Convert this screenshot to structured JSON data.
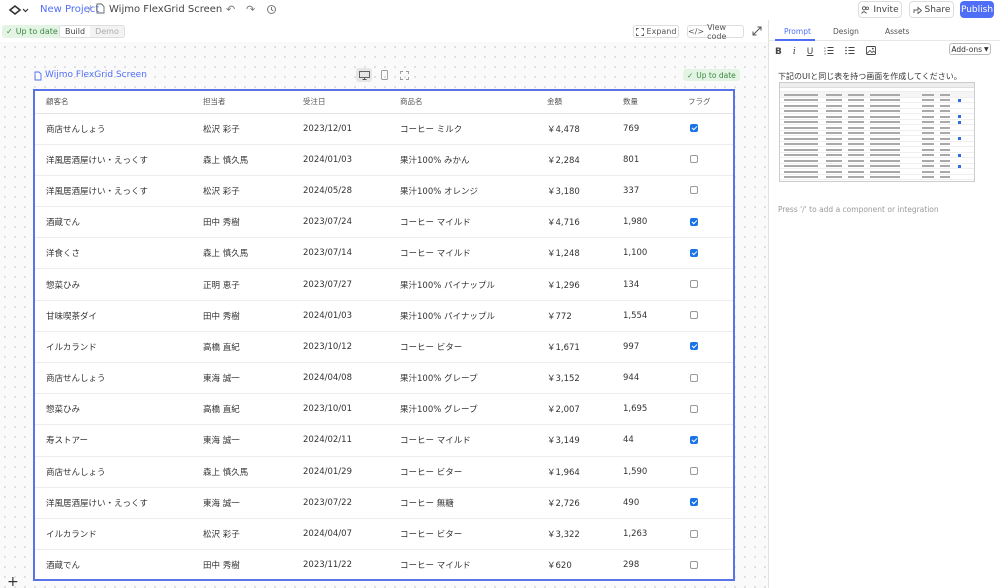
{
  "header": {
    "project_link": "New Project",
    "separator": "/",
    "file_name": "Wijmo FlexGrid Screen",
    "invite_label": "Invite",
    "share_label": "Share",
    "publish_label": "Publish"
  },
  "subbar": {
    "status_badge": "Up to date",
    "mode_build": "Build",
    "mode_demo": "Demo",
    "expand_label": "Expand",
    "view_code_label": "View code"
  },
  "frame": {
    "title": "Wijmo FlexGrid Screen",
    "status_badge": "Up to date"
  },
  "grid": {
    "columns": [
      "顧客名",
      "担当者",
      "受注日",
      "商品名",
      "金額",
      "数量",
      "フラグ"
    ],
    "rows": [
      {
        "customer": "商店せんしょう",
        "rep": "松沢 彩子",
        "date": "2023/12/01",
        "product": "コーヒー ミルク",
        "amount": "￥4,478",
        "qty": "769",
        "flag": true
      },
      {
        "customer": "洋風居酒屋けい・えっくす",
        "rep": "森上 慎久馬",
        "date": "2024/01/03",
        "product": "果汁100% みかん",
        "amount": "￥2,284",
        "qty": "801",
        "flag": false
      },
      {
        "customer": "洋風居酒屋けい・えっくす",
        "rep": "松沢 彩子",
        "date": "2024/05/28",
        "product": "果汁100% オレンジ",
        "amount": "￥3,180",
        "qty": "337",
        "flag": false
      },
      {
        "customer": "酒蔵でん",
        "rep": "田中 秀樹",
        "date": "2023/07/24",
        "product": "コーヒー マイルド",
        "amount": "￥4,716",
        "qty": "1,980",
        "flag": true
      },
      {
        "customer": "洋食くさ",
        "rep": "森上 慎久馬",
        "date": "2023/07/14",
        "product": "コーヒー マイルド",
        "amount": "￥1,248",
        "qty": "1,100",
        "flag": true
      },
      {
        "customer": "惣菜ひみ",
        "rep": "正明 恵子",
        "date": "2023/07/27",
        "product": "果汁100% パイナップル",
        "amount": "￥1,296",
        "qty": "134",
        "flag": false
      },
      {
        "customer": "甘味喫茶ダイ",
        "rep": "田中 秀樹",
        "date": "2024/01/03",
        "product": "果汁100% パイナップル",
        "amount": "￥772",
        "qty": "1,554",
        "flag": false
      },
      {
        "customer": "イルカランド",
        "rep": "高橋 直紀",
        "date": "2023/10/12",
        "product": "コーヒー ビター",
        "amount": "￥1,671",
        "qty": "997",
        "flag": true
      },
      {
        "customer": "商店せんしょう",
        "rep": "東海 誠一",
        "date": "2024/04/08",
        "product": "果汁100% グレープ",
        "amount": "￥3,152",
        "qty": "944",
        "flag": false
      },
      {
        "customer": "惣菜ひみ",
        "rep": "高橋 直紀",
        "date": "2023/10/01",
        "product": "果汁100% グレープ",
        "amount": "￥2,007",
        "qty": "1,695",
        "flag": false
      },
      {
        "customer": "寿ストアー",
        "rep": "東海 誠一",
        "date": "2024/02/11",
        "product": "コーヒー マイルド",
        "amount": "￥3,149",
        "qty": "44",
        "flag": true
      },
      {
        "customer": "商店せんしょう",
        "rep": "森上 慎久馬",
        "date": "2024/01/29",
        "product": "コーヒー ビター",
        "amount": "￥1,964",
        "qty": "1,590",
        "flag": false
      },
      {
        "customer": "洋風居酒屋けい・えっくす",
        "rep": "東海 誠一",
        "date": "2023/07/22",
        "product": "コーヒー 無糖",
        "amount": "￥2,726",
        "qty": "490",
        "flag": true
      },
      {
        "customer": "イルカランド",
        "rep": "松沢 彩子",
        "date": "2024/04/07",
        "product": "コーヒー ビター",
        "amount": "￥3,322",
        "qty": "1,263",
        "flag": false
      },
      {
        "customer": "酒蔵でん",
        "rep": "田中 秀樹",
        "date": "2023/11/22",
        "product": "コーヒー マイルド",
        "amount": "￥620",
        "qty": "298",
        "flag": false
      }
    ]
  },
  "panel": {
    "tabs": [
      "Prompt",
      "Design",
      "Assets"
    ],
    "active_tab": "Prompt",
    "toolbar": {
      "bold": "B",
      "italic": "i",
      "underline": "U",
      "icons": [
        "bold-icon",
        "italic-icon",
        "underline-icon",
        "numbered-list-icon",
        "bulleted-list-icon",
        "image-icon"
      ]
    },
    "addons_label": "Add-ons",
    "prompt_text": "下記のUIと同じ表を持つ画面を作成してください。",
    "placeholder": "Press '/' to add a component or integration"
  },
  "colors": {
    "accent": "#4f6ef7",
    "frame_border": "#5b73e8",
    "checkbox_checked": "#1a73e8",
    "status_green_bg": "#e3f4e4",
    "status_green_text": "#3a8a3f"
  }
}
